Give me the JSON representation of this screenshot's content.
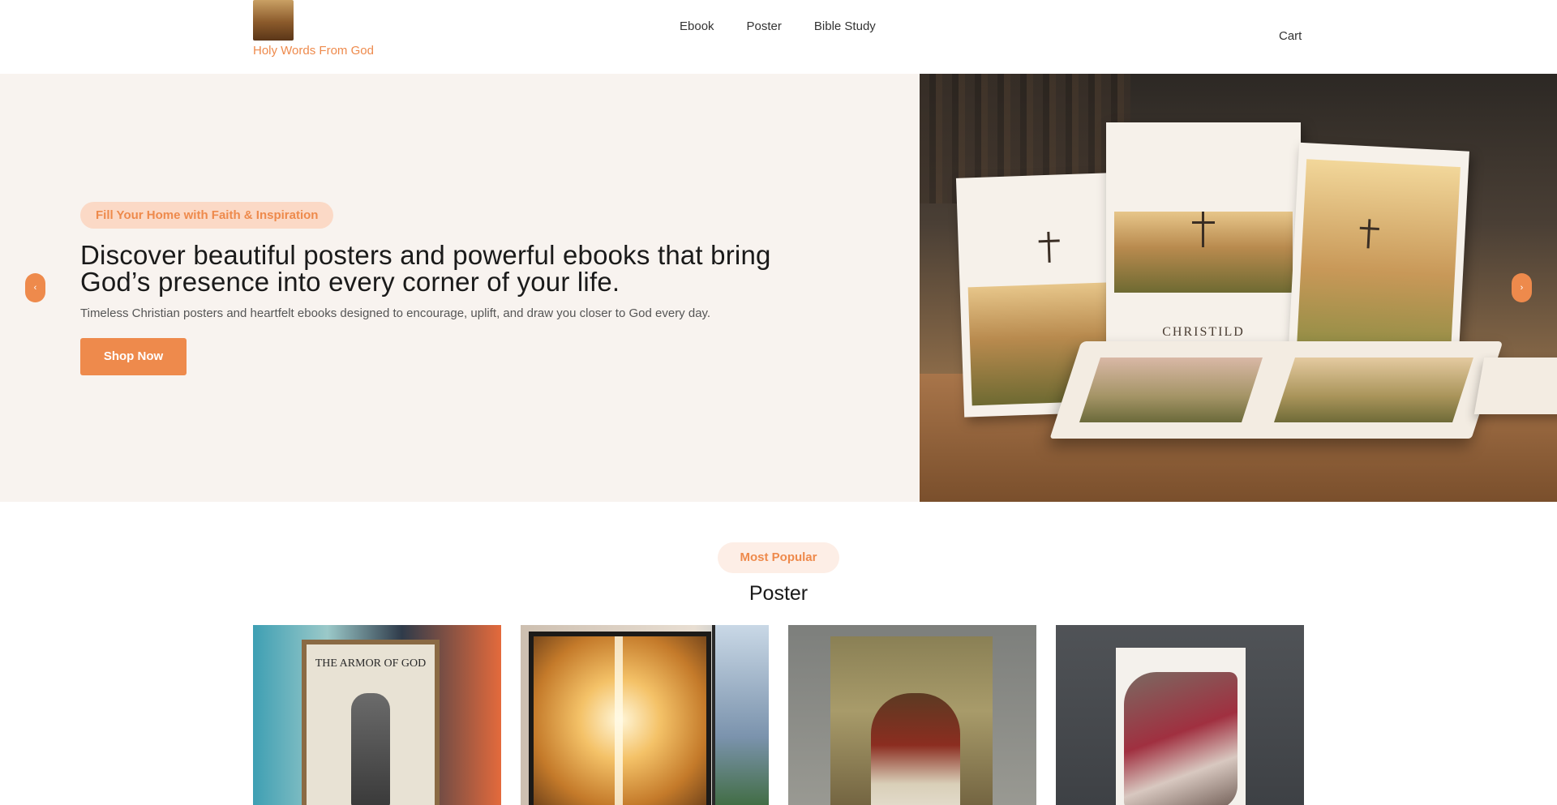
{
  "brand": {
    "name": "Holy Words From God",
    "logo_icon": "jesus-portrait-icon"
  },
  "nav": {
    "items": [
      "Ebook",
      "Poster",
      "Bible Study"
    ],
    "cart": "Cart"
  },
  "hero": {
    "pill": "Fill Your Home with Faith & Inspiration",
    "title": "Discover beautiful posters and powerful ebooks that bring God’s presence into every corner of your life.",
    "subtitle": "Timeless Christian posters and heartfelt ebooks designed to encourage, uplift, and draw you closer to God every day.",
    "cta": "Shop Now",
    "prev_icon": "chevron-left-icon",
    "next_icon": "chevron-right-icon",
    "image_book_title": "CHRISTILD"
  },
  "section": {
    "pill": "Most Popular",
    "title": "Poster",
    "cards": [
      {
        "image_text": "THE ARMOR OF GOD"
      },
      {},
      {},
      {}
    ]
  },
  "colors": {
    "accent": "#ee8a4c",
    "pill_bg": "#fbd9c6",
    "hero_bg": "#f8f3ef"
  }
}
